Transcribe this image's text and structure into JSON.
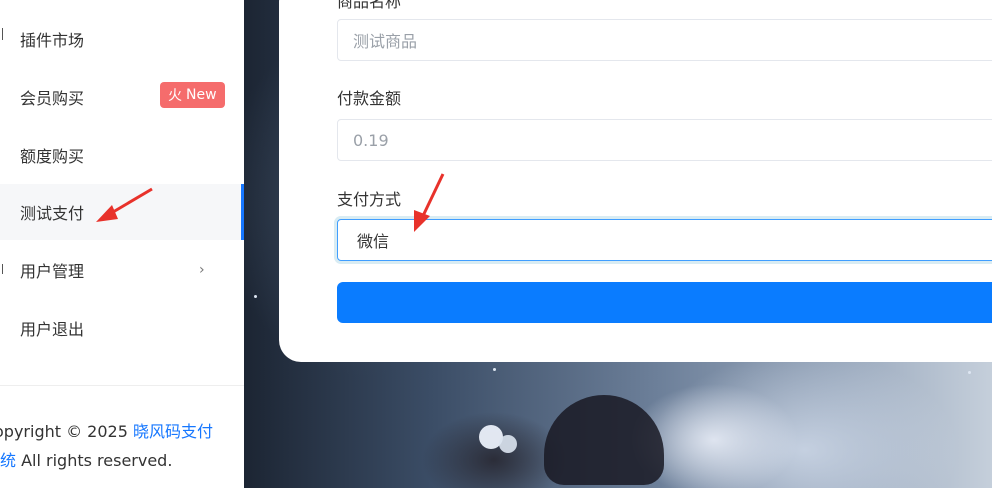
{
  "sidebar": {
    "items": [
      {
        "label": "插件市场"
      },
      {
        "label": "会员购买",
        "badge": {
          "icon": "fire-icon",
          "glyph": "火",
          "text": "New"
        }
      },
      {
        "label": "额度购买"
      },
      {
        "label": "测试支付",
        "active": true
      },
      {
        "label": "用户管理",
        "has_submenu": true
      },
      {
        "label": "用户退出"
      }
    ],
    "footer": {
      "line1_prefix": "opyright © 2025 ",
      "line1_link": "晓风码支付",
      "line2_link": "统",
      "line2_suffix": " All rights reserved."
    }
  },
  "form": {
    "product_label": "商品名称",
    "product_placeholder": "测试商品",
    "amount_label": "付款金额",
    "amount_value": "0.19",
    "method_label": "支付方式",
    "method_value": "微信",
    "submit_label": ""
  },
  "colors": {
    "accent": "#1677ff",
    "badge": "#f56c6c",
    "button": "#0a7cff",
    "arrow": "#e8322b"
  }
}
